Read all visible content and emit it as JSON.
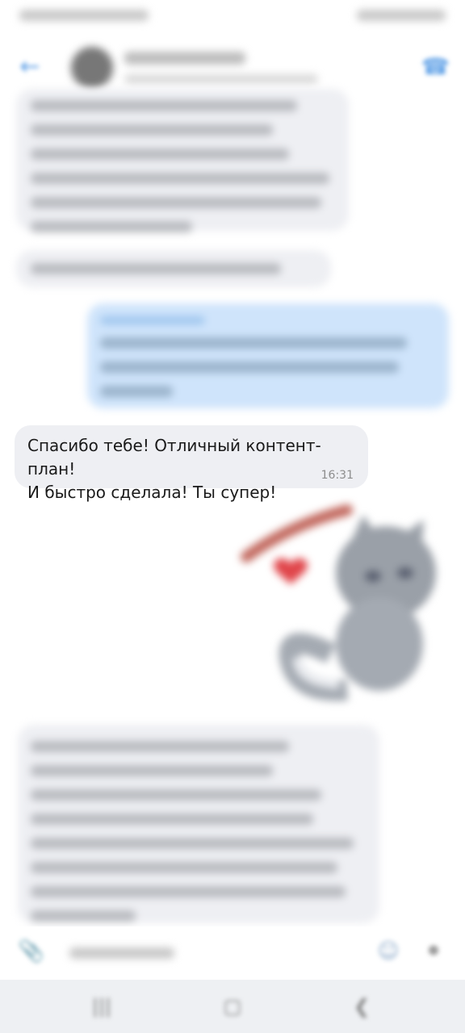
{
  "status_bar": {
    "time": "",
    "icons": ""
  },
  "header": {
    "contact_name": "",
    "contact_status": ""
  },
  "messages": [
    {
      "direction": "incoming",
      "text": "",
      "time": ""
    },
    {
      "direction": "incoming",
      "text": "",
      "time": ""
    },
    {
      "direction": "outgoing",
      "quote_name": "",
      "text": "",
      "time": ""
    },
    {
      "direction": "incoming",
      "text_line1": "Спасибо тебе! Отличный контент-план!",
      "text_line2": "И быстро сделала! Ты супер!",
      "time": "16:31"
    },
    {
      "direction": "incoming",
      "text": "",
      "time": ""
    }
  ],
  "composer": {
    "placeholder": ""
  },
  "colors": {
    "incoming_bubble": "#eeeff3",
    "outgoing_bubble": "#cfe4fb",
    "accent": "#5b9ee6"
  }
}
